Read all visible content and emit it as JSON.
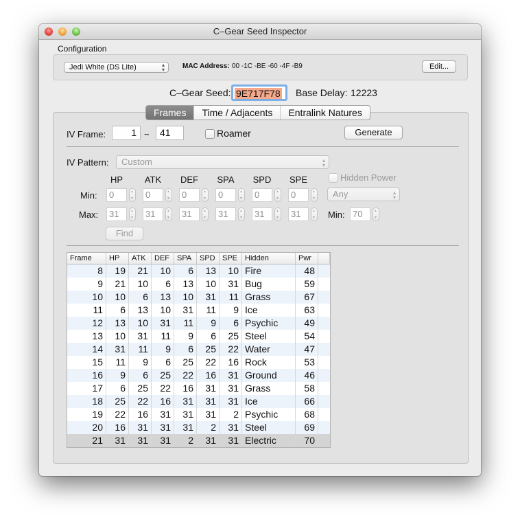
{
  "window": {
    "title": "C–Gear Seed Inspector"
  },
  "configuration": {
    "section_label": "Configuration",
    "profile_selected": "Jedi White (DS Lite)",
    "mac_label": "MAC Address:",
    "mac_value": "00 -1C -BE -60 -4F -B9",
    "edit_label": "Edit..."
  },
  "seed": {
    "label": "C–Gear Seed:",
    "value": "9E717F78",
    "base_delay_label": "Base Delay:",
    "base_delay_value": "12223"
  },
  "tabs": [
    {
      "label": "Frames",
      "active": true
    },
    {
      "label": "Time / Adjacents",
      "active": false
    },
    {
      "label": "Entralink Natures",
      "active": false
    }
  ],
  "frames": {
    "iv_frame_label": "IV Frame:",
    "frame_start": "1",
    "range_sep": "~",
    "frame_end": "41",
    "roamer_label": "Roamer",
    "roamer_checked": false,
    "generate_label": "Generate",
    "iv_pattern_label": "IV Pattern:",
    "iv_pattern_value": "Custom",
    "stat_headers": [
      "HP",
      "ATK",
      "DEF",
      "SPA",
      "SPD",
      "SPE"
    ],
    "min_label": "Min:",
    "max_label": "Max:",
    "min_values": [
      "0",
      "0",
      "0",
      "0",
      "0",
      "0"
    ],
    "max_values": [
      "31",
      "31",
      "31",
      "31",
      "31",
      "31"
    ],
    "hidden_power_label": "Hidden Power",
    "hidden_power_checked": false,
    "hidden_power_type": "Any",
    "hp_min_label": "Min:",
    "hp_min_value": "70",
    "find_label": "Find"
  },
  "results": {
    "columns": [
      "Frame",
      "HP",
      "ATK",
      "DEF",
      "SPA",
      "SPD",
      "SPE",
      "Hidden",
      "Pwr",
      ""
    ],
    "rows": [
      [
        "8",
        "19",
        "21",
        "10",
        "6",
        "13",
        "10",
        "Fire",
        "48"
      ],
      [
        "9",
        "21",
        "10",
        "6",
        "13",
        "10",
        "31",
        "Bug",
        "59"
      ],
      [
        "10",
        "10",
        "6",
        "13",
        "10",
        "31",
        "11",
        "Grass",
        "67"
      ],
      [
        "11",
        "6",
        "13",
        "10",
        "31",
        "11",
        "9",
        "Ice",
        "63"
      ],
      [
        "12",
        "13",
        "10",
        "31",
        "11",
        "9",
        "6",
        "Psychic",
        "49"
      ],
      [
        "13",
        "10",
        "31",
        "11",
        "9",
        "6",
        "25",
        "Steel",
        "54"
      ],
      [
        "14",
        "31",
        "11",
        "9",
        "6",
        "25",
        "22",
        "Water",
        "47"
      ],
      [
        "15",
        "11",
        "9",
        "6",
        "25",
        "22",
        "16",
        "Rock",
        "53"
      ],
      [
        "16",
        "9",
        "6",
        "25",
        "22",
        "16",
        "31",
        "Ground",
        "46"
      ],
      [
        "17",
        "6",
        "25",
        "22",
        "16",
        "31",
        "31",
        "Grass",
        "58"
      ],
      [
        "18",
        "25",
        "22",
        "16",
        "31",
        "31",
        "31",
        "Ice",
        "66"
      ],
      [
        "19",
        "22",
        "16",
        "31",
        "31",
        "31",
        "2",
        "Psychic",
        "68"
      ],
      [
        "20",
        "16",
        "31",
        "31",
        "31",
        "2",
        "31",
        "Steel",
        "69"
      ],
      [
        "21",
        "31",
        "31",
        "31",
        "2",
        "31",
        "31",
        "Electric",
        "70"
      ]
    ],
    "selected_row": 13
  }
}
